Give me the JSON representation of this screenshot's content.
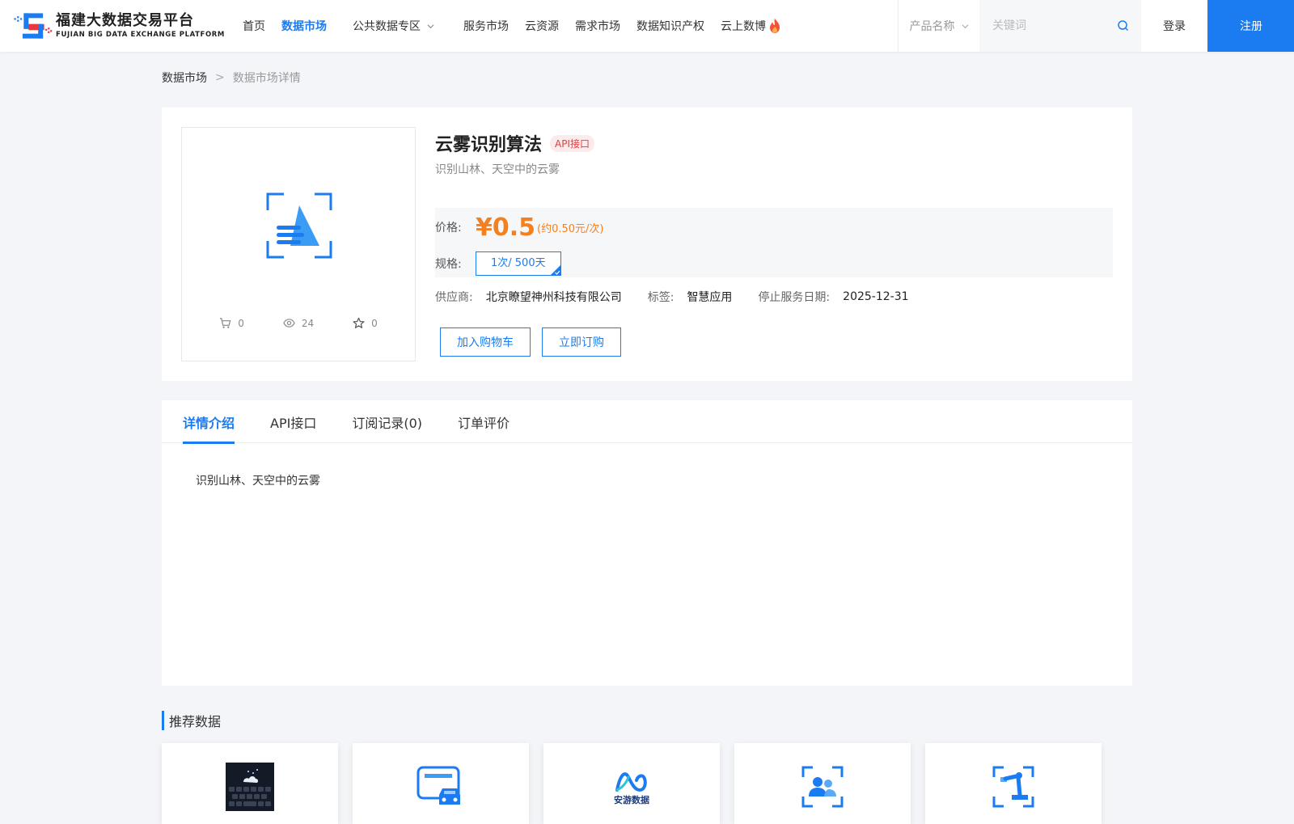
{
  "header": {
    "logo_cn": "福建大数据交易平台",
    "logo_en": "FUJIAN BIG DATA EXCHANGE  PLATFORM",
    "nav": [
      {
        "label": "首页"
      },
      {
        "label": "数据市场",
        "active": true
      },
      {
        "label": "公共数据专区"
      },
      {
        "label": "服务市场"
      },
      {
        "label": "云资源"
      },
      {
        "label": "需求市场"
      },
      {
        "label": "数据知识产权"
      },
      {
        "label": "云上数博"
      }
    ],
    "search_type": "产品名称",
    "search_placeholder": "关键词",
    "login": "登录",
    "register": "注册",
    "brand_color": "#1b7cf2"
  },
  "breadcrumb": {
    "home": "数据市场",
    "sep": ">",
    "current": "数据市场详情"
  },
  "product": {
    "title": "云雾识别算法",
    "tag": "API接口",
    "subtitle": "识别山林、天空中的云雾",
    "stats": {
      "cart": "0",
      "views": "24",
      "favorites": "0"
    },
    "price_label": "价格:",
    "price": "¥0.5",
    "price_note": "(约0.50元/次)",
    "spec_label": "规格:",
    "spec_value": "1次/ 500天",
    "supplier_label": "供应商:",
    "supplier": "北京瞭望神州科技有限公司",
    "tag_label": "标签:",
    "tag_value": "智慧应用",
    "stop_label": "停止服务日期:",
    "stop_date": "2025-12-31",
    "add_cart": "加入购物车",
    "subscribe": "立即订购",
    "price_color": "#f4801f"
  },
  "tabs": [
    {
      "label": "详情介绍",
      "active": true
    },
    {
      "label": "API接口"
    },
    {
      "label": "订阅记录(0)"
    },
    {
      "label": "订单评价"
    }
  ],
  "detail_text": "识别山林、天空中的云雾",
  "recommend": {
    "title": "推荐数据",
    "items": [
      {
        "icon": "keyboard-cloud-image"
      },
      {
        "icon": "vehicle-card-icon"
      },
      {
        "icon": "anyou-data-logo",
        "logo_text": "安游数据"
      },
      {
        "icon": "people-scan-icon"
      },
      {
        "icon": "robot-arm-scan-icon"
      }
    ]
  }
}
